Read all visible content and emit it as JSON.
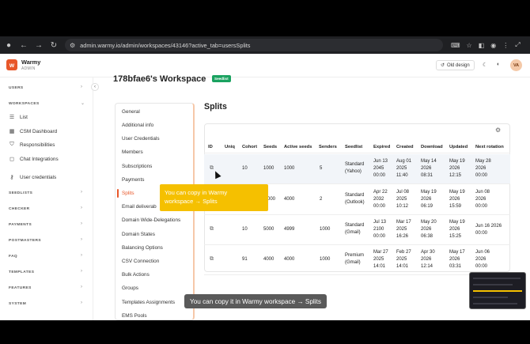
{
  "browser": {
    "url": "admin.warmy.io/admin/workspaces/43146?active_tab=usersSplits"
  },
  "app": {
    "brand": "Warmy",
    "brand_sub": "ADMIN",
    "old_design_label": "Old design",
    "avatar_initials": "VA",
    "accent_color": "#e8572a"
  },
  "sidebar": {
    "sections": [
      {
        "label": "USERS"
      },
      {
        "label": "WORKSPACES"
      },
      {
        "label": "SEEDLISTS"
      },
      {
        "label": "CHECKER"
      },
      {
        "label": "PAYMENTS"
      },
      {
        "label": "POSTMASTERS"
      },
      {
        "label": "FAQ"
      },
      {
        "label": "TEMPLATES"
      },
      {
        "label": "FEATURES"
      },
      {
        "label": "SYSTEM"
      }
    ],
    "items": [
      {
        "label": "List",
        "icon": "list-icon"
      },
      {
        "label": "CSM Dashboard",
        "icon": "dashboard-icon"
      },
      {
        "label": "Responsibilities",
        "icon": "shield-icon"
      },
      {
        "label": "Chat Integrations",
        "icon": "chat-icon"
      },
      {
        "label": "User credentials",
        "icon": "key-icon"
      }
    ]
  },
  "workspace": {
    "title": "178bfae6's Workspace",
    "badge": "Seedlist"
  },
  "subnav": {
    "items": [
      "General",
      "Additional info",
      "User Credentials",
      "Members",
      "Subscriptions",
      "Payments",
      "Splits",
      "Email deliverab",
      "Domain Wide-Delegations",
      "Domain States",
      "Balancing Options",
      "CSV Connection",
      "Bulk Actions",
      "Groups",
      "Templates Assignments",
      "EMS Pools"
    ],
    "active_index": 6
  },
  "splits": {
    "title": "Splits",
    "columns": [
      "ID",
      "Uniq",
      "Cohort",
      "Seeds",
      "Active seeds",
      "Senders",
      "Seedlist",
      "Expired",
      "Created",
      "Download",
      "Updated",
      "Next rotation"
    ],
    "rows": [
      {
        "uniq": "",
        "cohort": "10",
        "seeds": "1000",
        "active": "1000",
        "senders": "5",
        "seedlist": [
          "Standard",
          "(Yahoo)"
        ],
        "expired": [
          "Jun 13",
          "2045",
          "00:00"
        ],
        "created": [
          "Aug 01",
          "2025",
          "11:40"
        ],
        "download": [
          "May 14",
          "2026",
          "08:31"
        ],
        "updated": [
          "May 19",
          "2026",
          "12:15"
        ],
        "next": [
          "May 28",
          "2026",
          "00:00"
        ]
      },
      {
        "uniq": "",
        "cohort": "",
        "seeds": "000",
        "active": "4000",
        "senders": "2",
        "seedlist": [
          "Standard",
          "(Outlook)"
        ],
        "expired": [
          "Apr 22",
          "2032",
          "00:00"
        ],
        "created": [
          "Jul 08",
          "2025",
          "10:12"
        ],
        "download": [
          "May 19",
          "2026",
          "06:19"
        ],
        "updated": [
          "May 19",
          "2026",
          "15:59"
        ],
        "next": [
          "Jun 08",
          "2026",
          "00:00"
        ]
      },
      {
        "uniq": "",
        "cohort": "10",
        "seeds": "5000",
        "active": "4999",
        "senders": "1000",
        "seedlist": [
          "Standard",
          "(Gmail)"
        ],
        "expired": [
          "Jul 13",
          "2100",
          "00:00"
        ],
        "created": [
          "Mar 17",
          "2025",
          "16:26"
        ],
        "download": [
          "May 20",
          "2026",
          "06:38"
        ],
        "updated": [
          "May 19",
          "2026",
          "15:25"
        ],
        "next": [
          "Jun 16 2026",
          "00:00",
          ""
        ]
      },
      {
        "uniq": "",
        "cohort": "91",
        "seeds": "4000",
        "active": "4000",
        "senders": "1000",
        "seedlist": [
          "Premium",
          "(Gmail)"
        ],
        "expired": [
          "Mar 27",
          "2025",
          "14:01"
        ],
        "created": [
          "Feb 27",
          "2025",
          "14:01"
        ],
        "download": [
          "Apr 30",
          "2026",
          "12:14"
        ],
        "updated": [
          "May 17",
          "2026",
          "03:31"
        ],
        "next": [
          "Jun 06",
          "2026",
          "00:00"
        ]
      }
    ]
  },
  "tooltip": {
    "line1": "You can copy in Warmy",
    "line2": "workspace → Splits"
  },
  "caption": "You can copy it in Warmy workspace → Splits"
}
